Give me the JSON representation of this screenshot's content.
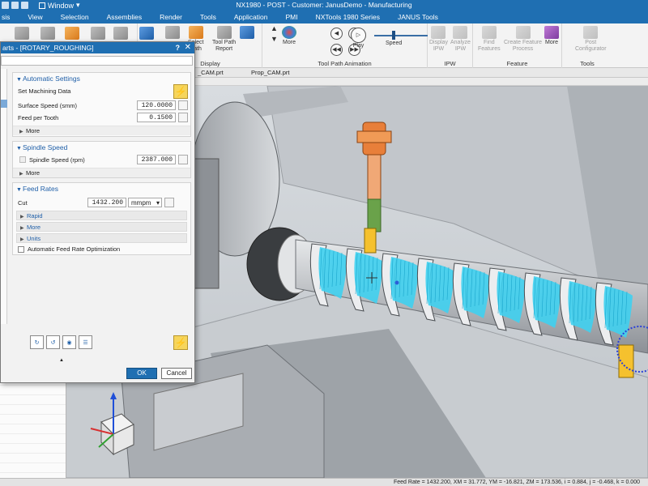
{
  "titlebar": {
    "window_menu": "Window",
    "title": "NX1980 - POST - Customer: JanusDemo - Manufacturing"
  },
  "menubar": [
    "sis",
    "View",
    "Selection",
    "Assemblies",
    "Render",
    "Tools",
    "Application",
    "PMI",
    "NXTools 1980 Series",
    "JANUS Tools"
  ],
  "ribbon": {
    "display": {
      "label": "Display",
      "select_path": "Select\nPath",
      "tool_path_report": "Tool Path\nReport",
      "more": "More"
    },
    "animation": {
      "label": "Tool Path Animation",
      "play": "Play",
      "speed": "Speed",
      "speed_level": 0.35
    },
    "ipw": {
      "label": "IPW",
      "display_ipw": "Display\nIPW",
      "analyze_ipw": "Analyze\nIPW"
    },
    "feature": {
      "label": "Feature",
      "find_features": "Find\nFeatures",
      "create_feature_process": "Create Feature\nProcess",
      "more": "More"
    },
    "tools": {
      "label": "Tools",
      "post_configurator": "Post\nConfigurator"
    }
  },
  "tabs": [
    "_CAM.prt",
    "Prop_CAM.prt"
  ],
  "dialog": {
    "title": "arts - [ROTARY_ROUGHING]",
    "help": "?",
    "close": "✕",
    "automatic_settings": {
      "heading": "Automatic Settings",
      "set_machining_data": "Set Machining Data",
      "surface_speed_label": "Surface Speed (smm)",
      "surface_speed": "120.0000",
      "feed_per_tooth_label": "Feed per Tooth",
      "feed_per_tooth": "0.1500",
      "more": "More"
    },
    "spindle_speed": {
      "heading": "Spindle Speed",
      "label": "Spindle Speed (rpm)",
      "value": "2387.000",
      "more": "More"
    },
    "feed_rates": {
      "heading": "Feed Rates",
      "cut_label": "Cut",
      "cut_value": "1432.200",
      "cut_unit": "mmpm",
      "rapid": "Rapid",
      "more": "More",
      "units": "Units",
      "auto_opt": "Automatic Feed Rate Optimization"
    },
    "ok": "OK",
    "cancel": "Cancel"
  },
  "status": {
    "text": "Feed Rate = 1432.200, XM = 31.772, YM = -16.821, ZM = 173.536, i = 0.884, j = -0.468, k = 0.000"
  },
  "colors": {
    "brand_blue": "#1f6fb2",
    "toolpath_cyan": "#3fd0f0",
    "tool_orange": "#e87f3a",
    "tool_gold": "#f5c12e",
    "tool_green": "#6aa24a"
  },
  "icons": [
    "search-icon",
    "lightning-icon",
    "calculator-icon",
    "lock-icon",
    "play-icon",
    "rewind-icon",
    "forward-icon",
    "speed-slider-icon"
  ]
}
